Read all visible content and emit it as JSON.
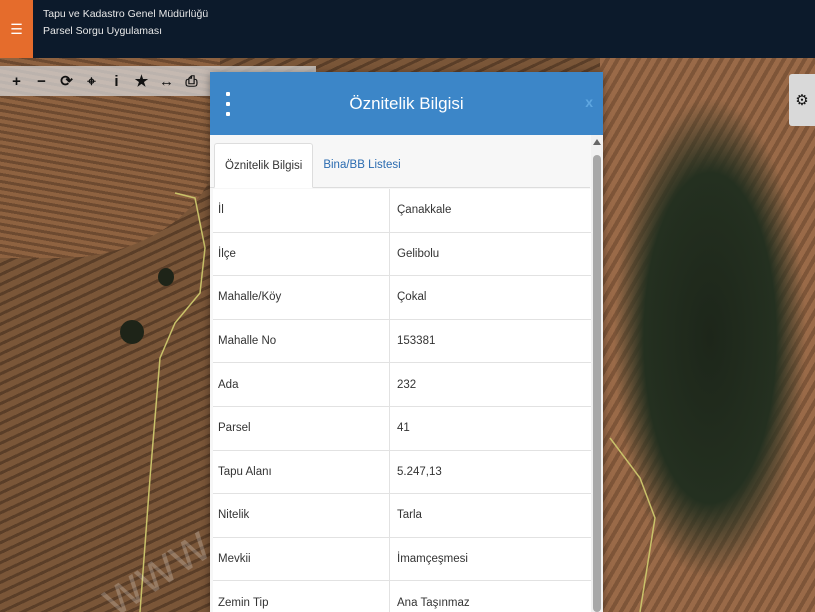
{
  "header": {
    "menu_icon": "hamburger-icon",
    "title_line1": "Tapu ve Kadastro Genel Müdürlüğü",
    "title_line2": "Parsel Sorgu Uygulaması",
    "bg_color": "#0c1a2b",
    "accent_color": "#e56c2c"
  },
  "toolbar": {
    "tools": [
      {
        "name": "zoom-in-icon",
        "glyph": "+"
      },
      {
        "name": "zoom-out-icon",
        "glyph": "−"
      },
      {
        "name": "refresh-icon",
        "glyph": "⟳"
      },
      {
        "name": "locate-icon",
        "glyph": "⌖"
      },
      {
        "name": "info-icon",
        "glyph": "i"
      },
      {
        "name": "star-icon",
        "glyph": "★"
      },
      {
        "name": "measure-icon",
        "glyph": "↔"
      },
      {
        "name": "print-icon",
        "glyph": "⎙"
      }
    ],
    "settings_icon": "gear-icon"
  },
  "map": {
    "watermark": "www.tapu-ilan.net.tr"
  },
  "dialog": {
    "title": "Öznitelik Bilgisi",
    "close_label": "x",
    "header_color": "#3c86c8",
    "tabs": [
      {
        "label": "Öznitelik Bilgisi",
        "active": true
      },
      {
        "label": "Bina/BB Listesi",
        "active": false
      }
    ],
    "rows": [
      {
        "key": "İl",
        "value": "Çanakkale"
      },
      {
        "key": "İlçe",
        "value": "Gelibolu"
      },
      {
        "key": "Mahalle/Köy",
        "value": "Çokal"
      },
      {
        "key": "Mahalle No",
        "value": "153381"
      },
      {
        "key": "Ada",
        "value": "232"
      },
      {
        "key": "Parsel",
        "value": "41"
      },
      {
        "key": "Tapu Alanı",
        "value": "5.247,13"
      },
      {
        "key": "Nitelik",
        "value": "Tarla"
      },
      {
        "key": "Mevkii",
        "value": "İmamçeşmesi"
      },
      {
        "key": "Zemin Tip",
        "value": "Ana Taşınmaz"
      }
    ]
  }
}
